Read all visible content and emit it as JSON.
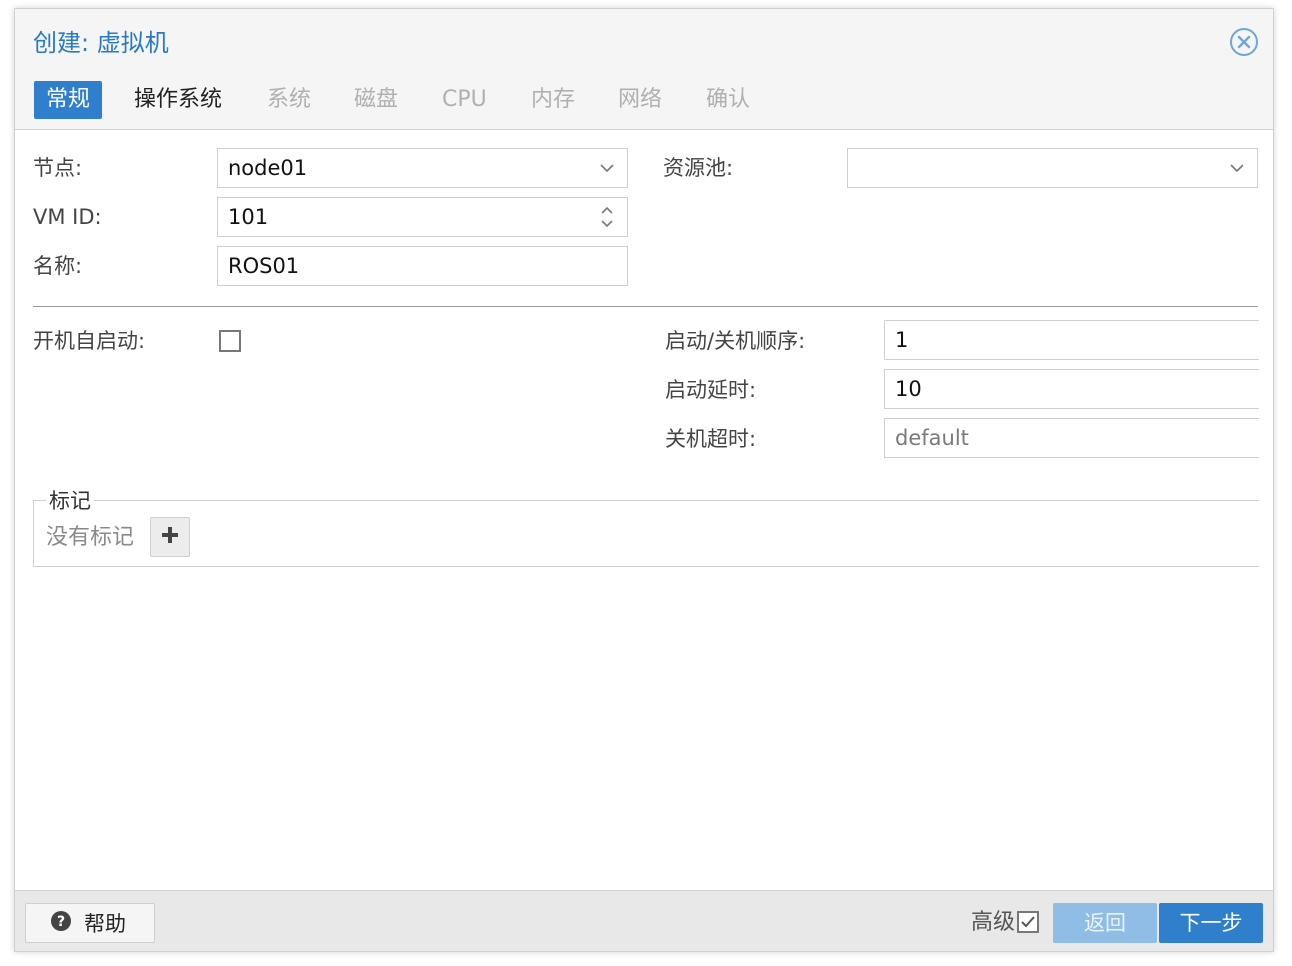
{
  "window": {
    "title": "创建: 虚拟机"
  },
  "tabs": [
    {
      "label": "常规",
      "state": "active"
    },
    {
      "label": "操作系统",
      "state": "enabled"
    },
    {
      "label": "系统",
      "state": "disabled"
    },
    {
      "label": "磁盘",
      "state": "disabled"
    },
    {
      "label": "CPU",
      "state": "disabled"
    },
    {
      "label": "内存",
      "state": "disabled"
    },
    {
      "label": "网络",
      "state": "disabled"
    },
    {
      "label": "确认",
      "state": "disabled"
    }
  ],
  "form": {
    "node": {
      "label": "节点:",
      "value": "node01"
    },
    "vmid": {
      "label": "VM ID:",
      "value": "101"
    },
    "name": {
      "label": "名称:",
      "value": "ROS01"
    },
    "pool": {
      "label": "资源池:",
      "value": ""
    },
    "onboot": {
      "label": "开机自启动:",
      "checked": false
    },
    "order": {
      "label": "启动/关机顺序:",
      "value": "1"
    },
    "startup_delay": {
      "label": "启动延时:",
      "value": "10"
    },
    "shutdown_timeout": {
      "label": "关机超时:",
      "placeholder": "default"
    }
  },
  "tags": {
    "legend": "标记",
    "empty_text": "没有标记"
  },
  "footer": {
    "help_label": "帮助",
    "advanced_label": "高级",
    "advanced_checked": true,
    "back_label": "返回",
    "next_label": "下一步"
  },
  "colors": {
    "accent": "#2f7fcc",
    "title": "#2a79c4",
    "disabled_button": "#8fbde6"
  },
  "icons": {
    "close": "close-circle-icon",
    "dropdown": "chevron-down-icon",
    "spinner": "spinner-icon",
    "add": "plus-icon",
    "help": "question-circle-icon",
    "check": "checkbox-checked-icon"
  }
}
